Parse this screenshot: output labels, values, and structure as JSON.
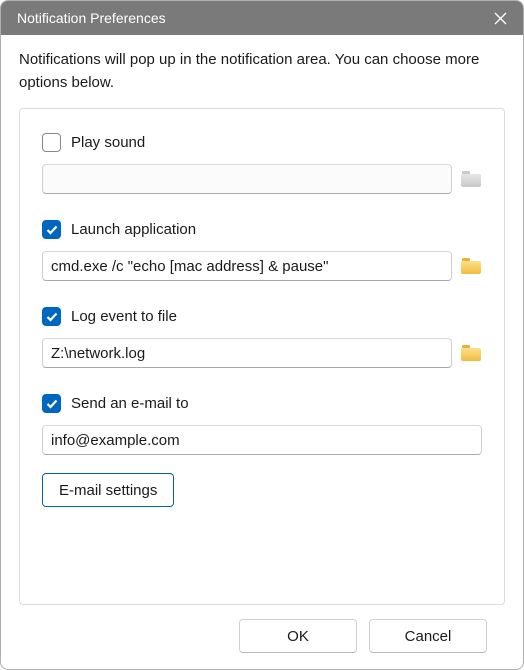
{
  "title": "Notification Preferences",
  "intro": "Notifications will pop up in the notification area. You can choose more options below.",
  "playSound": {
    "label": "Play sound",
    "checked": false,
    "value": ""
  },
  "launchApp": {
    "label": "Launch application",
    "checked": true,
    "value": "cmd.exe /c \"echo [mac address] & pause\""
  },
  "logEvent": {
    "label": "Log event to file",
    "checked": true,
    "value": "Z:\\network.log"
  },
  "sendEmail": {
    "label": "Send an e-mail to",
    "checked": true,
    "value": "info@example.com"
  },
  "emailSettingsLabel": "E-mail settings",
  "buttons": {
    "ok": "OK",
    "cancel": "Cancel"
  }
}
